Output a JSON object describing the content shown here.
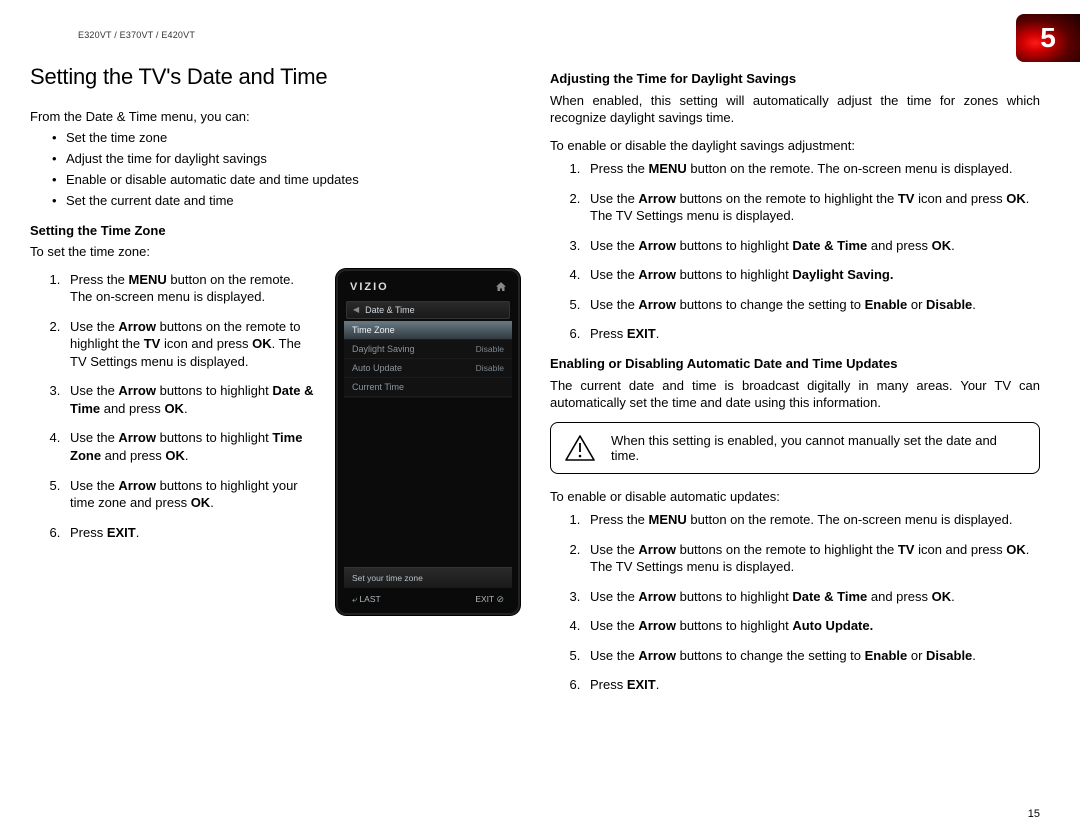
{
  "header": {
    "model_line": "E320VT / E370VT / E420VT",
    "chapter_number": "5",
    "page_number": "15"
  },
  "section_title": "Setting the TV's Date and Time",
  "intro_line": "From the Date & Time menu, you can:",
  "intro_bullets": [
    "Set the time zone",
    "Adjust the time for daylight savings",
    "Enable or disable automatic date and time updates",
    "Set the current date and time"
  ],
  "time_zone": {
    "heading": "Setting the Time Zone",
    "lead": "To set the time zone:",
    "steps": [
      {
        "pre": "Press the ",
        "b1": "MENU",
        "post1": " button on the remote. The on-screen menu is displayed."
      },
      {
        "pre": "Use the ",
        "b1": "Arrow",
        "mid1": " buttons on the remote to highlight the ",
        "b2": "TV",
        "mid2": " icon and press ",
        "b3": "OK",
        "post1": ". The TV Settings menu is displayed."
      },
      {
        "pre": "Use the ",
        "b1": "Arrow",
        "mid1": " buttons to highlight ",
        "b2": "Date & Time",
        "mid2": " and press ",
        "b3": "OK",
        "post1": "."
      },
      {
        "pre": "Use the ",
        "b1": "Arrow",
        "mid1": " buttons to highlight ",
        "b2": "Time Zone",
        "mid2": " and press ",
        "b3": "OK",
        "post1": "."
      },
      {
        "pre": "Use the ",
        "b1": "Arrow",
        "mid1": " buttons to highlight your time zone and press ",
        "b2": "OK",
        "post1": "."
      },
      {
        "pre": "Press ",
        "b1": "EXIT",
        "post1": "."
      }
    ]
  },
  "device_screen": {
    "brand": "VIZIO",
    "breadcrumb": "Date & Time",
    "rows": [
      {
        "label": "Time Zone",
        "value": "",
        "selected": true
      },
      {
        "label": "Daylight Saving",
        "value": "Disable",
        "selected": false
      },
      {
        "label": "Auto Update",
        "value": "Disable",
        "selected": false
      },
      {
        "label": "Current Time",
        "value": "",
        "selected": false
      }
    ],
    "help_text": "Set your time zone",
    "bottom_left": "LAST",
    "bottom_right": "EXIT"
  },
  "daylight": {
    "heading": "Adjusting the Time for Daylight Savings",
    "desc": "When enabled, this setting will automatically adjust the time for zones which recognize daylight savings time.",
    "lead": "To enable or disable the daylight savings adjustment:",
    "steps": [
      {
        "pre": "Press the ",
        "b1": "MENU",
        "post1": " button on the remote. The on-screen menu is displayed."
      },
      {
        "pre": "Use the ",
        "b1": "Arrow",
        "mid1": " buttons on the remote to highlight the ",
        "b2": "TV",
        "mid2": " icon and press ",
        "b3": "OK",
        "post1": ". The TV Settings menu is displayed."
      },
      {
        "pre": "Use the ",
        "b1": "Arrow",
        "mid1": " buttons to highlight ",
        "b2": "Date & Time",
        "mid2": " and press ",
        "b3": "OK",
        "post1": "."
      },
      {
        "pre": "Use the ",
        "b1": "Arrow",
        "mid1": " buttons to highlight ",
        "b2": "Daylight Saving.",
        "post1": ""
      },
      {
        "pre": "Use the ",
        "b1": "Arrow",
        "mid1": " buttons to change the setting to ",
        "b2": "Enable",
        "mid2": " or ",
        "b3": "Disable",
        "post1": "."
      },
      {
        "pre": "Press ",
        "b1": "EXIT",
        "post1": "."
      }
    ]
  },
  "auto_update": {
    "heading": "Enabling or Disabling Automatic Date and Time Updates",
    "desc": "The current date and time is broadcast digitally in many areas. Your TV can automatically set the time and date using this information.",
    "warning": "When this setting is enabled, you cannot manually set the date and time.",
    "lead": "To enable or disable automatic updates:",
    "steps": [
      {
        "pre": "Press the ",
        "b1": "MENU",
        "post1": " button on the remote. The on-screen menu is displayed."
      },
      {
        "pre": "Use the ",
        "b1": "Arrow",
        "mid1": " buttons on the remote to highlight the ",
        "b2": "TV",
        "mid2": " icon and press ",
        "b3": "OK",
        "post1": ". The TV Settings menu is displayed."
      },
      {
        "pre": "Use the ",
        "b1": "Arrow",
        "mid1": " buttons to highlight ",
        "b2": "Date & Time",
        "mid2": " and press ",
        "b3": "OK",
        "post1": "."
      },
      {
        "pre": "Use the ",
        "b1": "Arrow",
        "mid1": " buttons to highlight ",
        "b2": "Auto Update.",
        "post1": ""
      },
      {
        "pre": "Use the ",
        "b1": "Arrow",
        "mid1": " buttons to change the setting to ",
        "b2": "Enable",
        "mid2": " or ",
        "b3": "Disable",
        "post1": "."
      },
      {
        "pre": "Press ",
        "b1": "EXIT",
        "post1": "."
      }
    ]
  }
}
